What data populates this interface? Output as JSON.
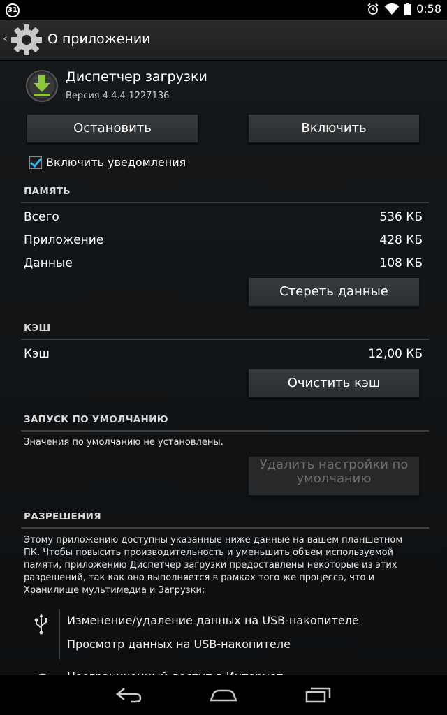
{
  "status": {
    "calendar_day": "31",
    "time": "0:58",
    "icons": [
      "alarm-icon",
      "wifi-icon",
      "battery-icon"
    ]
  },
  "actionbar": {
    "title": "О приложении"
  },
  "app": {
    "name": "Диспетчер загрузки",
    "version": "Версия 4.4.4-1227136"
  },
  "buttons": {
    "stop": "Остановить",
    "enable": "Включить",
    "clear_data": "Стереть данные",
    "clear_cache": "Очистить кэш",
    "clear_defaults": "Удалить настройки по умолчанию"
  },
  "notifications": {
    "label": "Включить уведомления",
    "checked": true
  },
  "memory": {
    "title": "ПАМЯТЬ",
    "rows": [
      {
        "label": "Всего",
        "value": "536 КБ"
      },
      {
        "label": "Приложение",
        "value": "428 КБ"
      },
      {
        "label": "Данные",
        "value": "108 КБ"
      }
    ]
  },
  "cache": {
    "title": "КЭШ",
    "rows": [
      {
        "label": "Кэш",
        "value": "12,00 КБ"
      }
    ]
  },
  "defaults": {
    "title": "ЗАПУСК ПО УМОЛЧАНИЮ",
    "text": "Значения по умолчанию не установлены."
  },
  "permissions": {
    "title": "РАЗРЕШЕНИЯ",
    "description_lines": [
      "Этому приложению доступны указанные ниже данные на вашем планшетном",
      "ПК. Чтобы повысить производительность и уменьшить объем используемой",
      "памяти, приложению Диспетчер загрузки предоставлены некоторые из этих",
      "разрешений, так как оно выполняется в рамках того же процесса, что и",
      "Хранилище мультимедиа и Загрузки:"
    ],
    "items": [
      "Изменение/удаление данных на USB-накопителе",
      "Просмотр данных на USB-накопителе",
      "Неограниченный доступ в Интернет"
    ]
  },
  "colors": {
    "accent": "#33b5e5",
    "background": "#0b0d0f",
    "divider": "#3c3e40"
  }
}
